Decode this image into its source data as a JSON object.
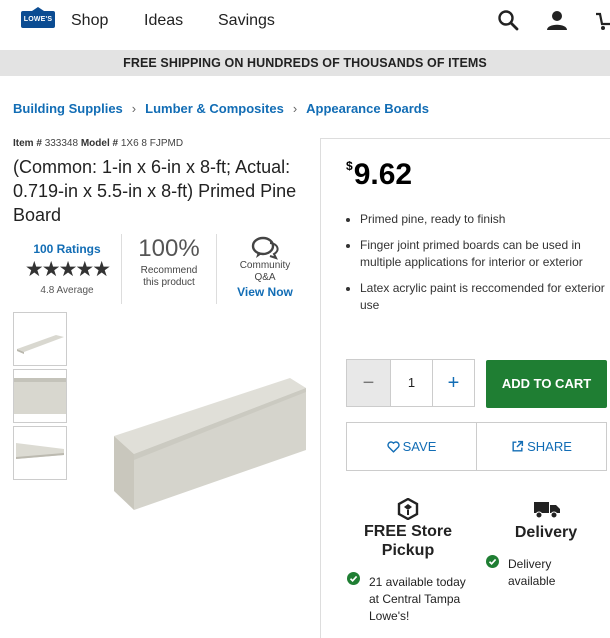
{
  "brand": {
    "logo_text": "LOWE'S",
    "accent": "#126db5",
    "logo_color": "#0b4c92"
  },
  "nav": {
    "shop": "Shop",
    "ideas": "Ideas",
    "savings": "Savings"
  },
  "icons": {
    "search": "search-icon",
    "account": "user-icon",
    "cart": "cart-icon"
  },
  "banner": "FREE SHIPPING ON HUNDREDS OF THOUSANDS OF ITEMS",
  "breadcrumb": [
    "Building Supplies",
    "Lumber & Composites",
    "Appearance Boards"
  ],
  "product": {
    "item_label": "Item #",
    "item_number": "333348",
    "model_label": "Model #",
    "model_number": "1X6 8 FJPMD",
    "title": "(Common: 1-in x 6-in x 8-ft; Actual: 0.719-in x 5.5-in x 8-ft) Primed Pine Board",
    "ratings_link": "100 Ratings",
    "rating_value": 4.8,
    "stars": 5,
    "average_text": "4.8 Average",
    "recommend_pct": "100%",
    "recommend_text": "Recommend this product",
    "community_text": "Community Q&A",
    "view_now": "View Now",
    "price_currency": "$",
    "price_value": "9.62",
    "features": [
      "Primed pine, ready to finish",
      "Finger joint primed boards can be used in multiple applications for interior or exterior",
      "Latex acrylic paint is reccomended for exterior use"
    ]
  },
  "purchase": {
    "quantity": "1",
    "minus": "−",
    "plus": "+",
    "add_to_cart": "ADD TO CART",
    "add_to_cart_color": "#1f7e33",
    "save": "SAVE",
    "share": "SHARE"
  },
  "fulfillment": {
    "pickup_title": "FREE Store Pickup",
    "pickup_detail": "21 available today at Central Tampa Lowe's!",
    "delivery_title": "Delivery",
    "delivery_detail": "Delivery available",
    "check_color": "#1f7e33"
  }
}
